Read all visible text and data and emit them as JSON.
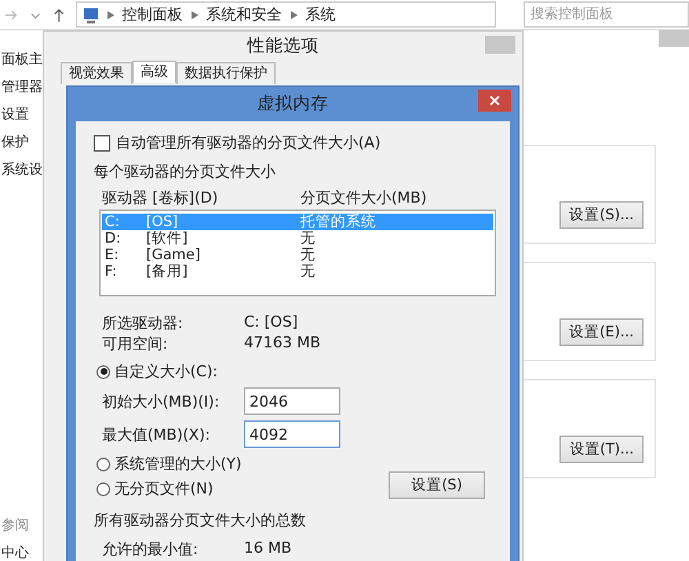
{
  "explorer": {
    "address_path": [
      "控制面板",
      "系统和安全",
      "系统"
    ],
    "search": {
      "placeholder": "搜索控制面板"
    },
    "sidebar": [
      "面板主",
      "管理器",
      "设置",
      "保护",
      "系统设"
    ],
    "see_also": [
      "参阅",
      "中心"
    ],
    "settings_buttons": [
      "设置(S)...",
      "设置(E)...",
      "设置(T)..."
    ]
  },
  "performance_options": {
    "title": "性能选项",
    "tabs": [
      {
        "label": "视觉效果",
        "selected": false
      },
      {
        "label": "高级",
        "selected": true
      },
      {
        "label": "数据执行保护",
        "selected": false
      }
    ]
  },
  "virtual_memory": {
    "title": "虚拟内存",
    "auto_manage": {
      "label": "自动管理所有驱动器的分页文件大小(A)",
      "checked": false
    },
    "group_title": "每个驱动器的分页文件大小",
    "columns": [
      "驱动器 [卷标](D)",
      "分页文件大小(MB)"
    ],
    "drives": [
      {
        "drive": "C:",
        "label": "[OS]",
        "size": "托管的系统",
        "selected": true
      },
      {
        "drive": "D:",
        "label": "[软件]",
        "size": "无",
        "selected": false
      },
      {
        "drive": "E:",
        "label": "[Game]",
        "size": "无",
        "selected": false
      },
      {
        "drive": "F:",
        "label": "[备用]",
        "size": "无",
        "selected": false
      }
    ],
    "selected_drive_label": "所选驱动器:",
    "selected_drive": "C:  [OS]",
    "free_space_label": "可用空间:",
    "free_space": "47163 MB",
    "options": [
      {
        "label": "自定义大小(C):",
        "selected": true
      },
      {
        "label": "系统管理的大小(Y)",
        "selected": false
      },
      {
        "label": "无分页文件(N)",
        "selected": false
      }
    ],
    "initial_size": {
      "label": "初始大小(MB)(I):",
      "value": "2046"
    },
    "maximum_size": {
      "label": "最大值(MB)(X):",
      "value": "4092"
    },
    "set_button": "设置(S)",
    "totals_title": "所有驱动器分页文件大小的总数",
    "min_allowed_label": "允许的最小值:",
    "min_allowed": "16 MB"
  }
}
